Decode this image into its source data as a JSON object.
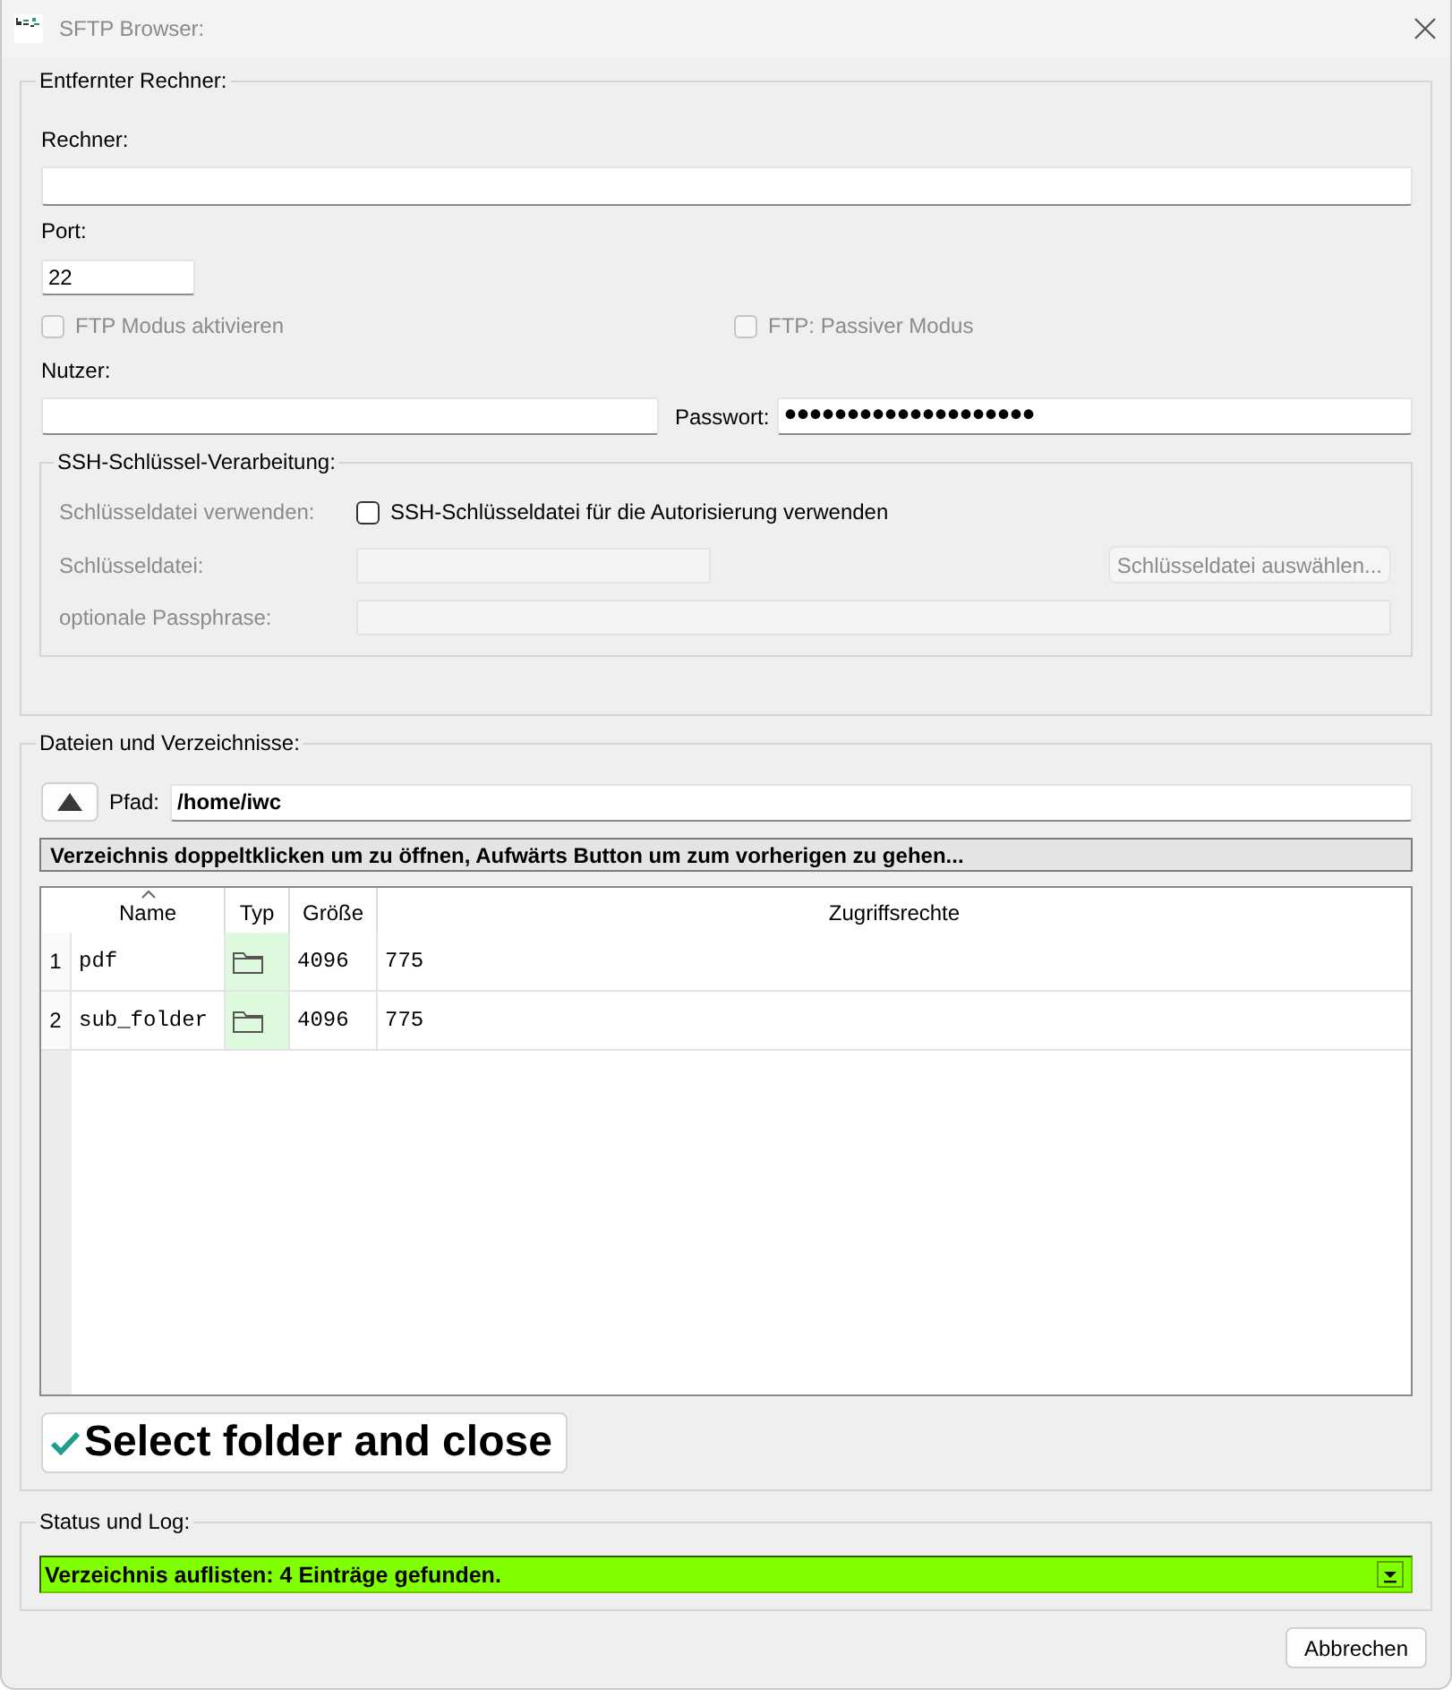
{
  "window": {
    "title": "SFTP Browser:"
  },
  "remote_host": {
    "title": "Entfernter Rechner:",
    "host": {
      "label": "Rechner:"
    },
    "port": {
      "label": "Port:",
      "value": "22"
    },
    "options": [
      {
        "label": "FTP Modus aktivieren",
        "checked": false,
        "disabled": true
      },
      {
        "label": "FTP: Passiver Modus",
        "checked": false,
        "disabled": true
      }
    ],
    "user": {
      "label": "Nutzer:"
    },
    "password": {
      "label": "Passwort:",
      "value": "••••••••••••••••••••"
    },
    "ssh_key": {
      "title": "SSH-Schlüssel-Verarbeitung:",
      "rows": [
        {
          "kind": "checkbox",
          "label": "Schlüsseldatei verwenden:",
          "disabled": true,
          "checkbox_label": "SSH-Schlüsseldatei für die Autorisierung verwenden",
          "checked": false
        },
        {
          "kind": "file",
          "label": "Schlüsseldatei:",
          "disabled": true,
          "button": "Schlüsseldatei auswählen..."
        },
        {
          "kind": "text",
          "label": "optionale Passphrase:",
          "disabled": true
        }
      ]
    }
  },
  "files": {
    "title": "Dateien und Verzeichnisse:",
    "path_label": "Pfad:",
    "path": "/home/iwc",
    "hint": "Verzeichnis doppeltklicken um zu öffnen, Aufwärts Button um zum vorherigen zu gehen...",
    "table": {
      "columns": [
        {
          "label": "Name",
          "sorted": true
        },
        {
          "label": "Typ",
          "sorted": false
        },
        {
          "label": "Größe",
          "sorted": false
        },
        {
          "label": "Zugriffsrechte",
          "sorted": false
        }
      ],
      "rows": [
        {
          "number": "1",
          "name": "pdf",
          "kind": "folder",
          "size": "4096",
          "permissions": "775",
          "selected": false
        },
        {
          "number": "2",
          "name": "sub_folder",
          "kind": "folder",
          "size": "4096",
          "permissions": "775",
          "selected": false
        }
      ]
    },
    "select_button": "Select folder and close"
  },
  "status": {
    "title": "Status und Log:",
    "message": "Verzeichnis auflisten: 4 Einträge gefunden."
  },
  "buttons": [
    "Abbrechen"
  ]
}
